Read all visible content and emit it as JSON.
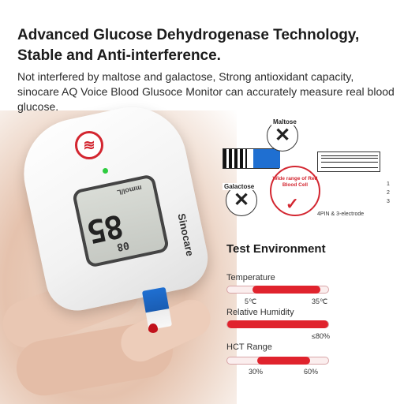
{
  "headline": {
    "line1": "Advanced Glucose Dehydrogenase Technology,",
    "line2": "Stable and Anti-interference."
  },
  "description": "Not interfered by maltose and galactose, Strong antioxidant capacity, sinocare AQ Voice Blood Glusoce Monitor can accurately measure real blood glucose.",
  "meter": {
    "reading": "85",
    "reading_small": "08",
    "unit": "mmol/L",
    "brand": "Sinocare"
  },
  "diagram": {
    "maltose_label": "Maltose",
    "galactose_label": "Galactose",
    "red_cell_text": "Wide range of Red Blood Cell",
    "pins": [
      "1",
      "2",
      "3"
    ],
    "electrode_caption": "4PIN & 3-electrode"
  },
  "environment": {
    "title": "Test Environment",
    "rows": [
      {
        "label": "Temperature",
        "low": "5℃",
        "high": "35℃",
        "from": 0.25,
        "to": 0.92
      },
      {
        "label": "Relative Humidity",
        "high": "≤80%",
        "from": 0.0,
        "to": 1.0
      },
      {
        "label": "HCT Range",
        "low": "30%",
        "high": "60%",
        "from": 0.3,
        "to": 0.82
      }
    ]
  },
  "colors": {
    "accent": "#e0232d",
    "strip_blue": "#1f6fd1"
  }
}
